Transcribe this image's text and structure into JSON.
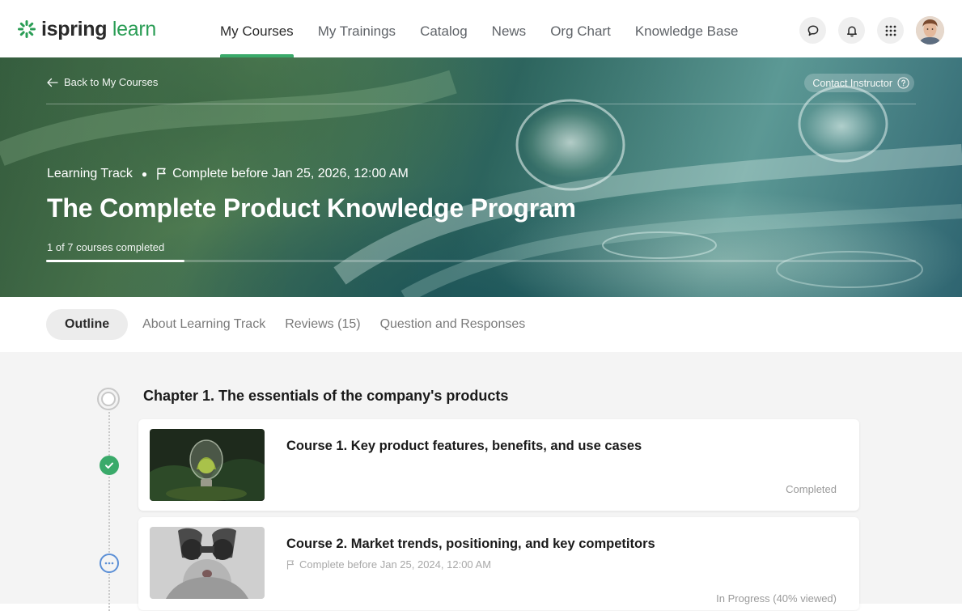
{
  "brand": {
    "name_part1": "ispring",
    "name_part2": "learn",
    "accent": "#2a9d55"
  },
  "nav": {
    "items": [
      {
        "label": "My Courses",
        "active": true
      },
      {
        "label": "My Trainings"
      },
      {
        "label": "Catalog"
      },
      {
        "label": "News"
      },
      {
        "label": "Org Chart"
      },
      {
        "label": "Knowledge Base"
      }
    ],
    "icons": [
      "chat-icon",
      "bell-icon",
      "apps-grid-icon"
    ]
  },
  "hero": {
    "back_label": "Back to My Courses",
    "contact_label": "Contact Instructor",
    "type_label": "Learning Track",
    "deadline_label": "Complete before Jan 25, 2026, 12:00 AM",
    "title": "The Complete Product Knowledge Program",
    "progress_label": "1 of 7 courses completed",
    "progress_fraction": 0.159
  },
  "tabs": [
    {
      "label": "Outline",
      "active": true
    },
    {
      "label": "About Learning Track"
    },
    {
      "label": "Reviews (15)"
    },
    {
      "label": "Question and Responses"
    }
  ],
  "chapter": {
    "title": "Chapter 1. The essentials of the company's products",
    "courses": [
      {
        "title": "Course 1. Key product features, benefits, and use cases",
        "status": "Completed",
        "state": "completed"
      },
      {
        "title": "Course 2. Market trends, positioning, and key competitors",
        "deadline": "Complete before Jan 25, 2024, 12:00 AM",
        "status": "In Progress (40% viewed)",
        "state": "in-progress"
      }
    ]
  },
  "colors": {
    "success": "#3aaa6a",
    "in_progress": "#5b8fd6"
  }
}
